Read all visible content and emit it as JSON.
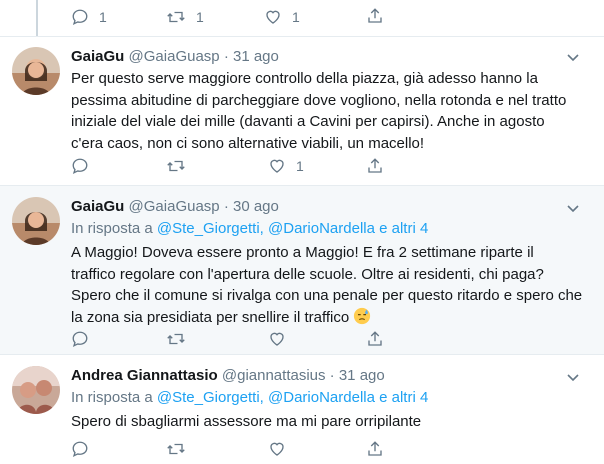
{
  "top_actions": {
    "reply_count": "1",
    "retweet_count": "1",
    "like_count": "1"
  },
  "tweets": [
    {
      "name": "GaiaGu",
      "handle": "@GaiaGuasp",
      "separator": "·",
      "time": "31 ago",
      "lines": [
        "Per questo serve maggiore controllo della piazza, già adesso hanno la",
        "pessima abitudine di parcheggiare dove vogliono, nella rotonda e nel tratto",
        "iniziale del viale dei mille (davanti a Cavini per capirsi). Anche in agosto",
        "c'era caos, non ci sono alternative viabili, un macello!"
      ],
      "reply_count": "",
      "retweet_count": "",
      "like_count": "1"
    },
    {
      "name": "GaiaGu",
      "handle": "@GaiaGuasp",
      "separator": "·",
      "time": "30 ago",
      "replying_prefix": "In risposta a ",
      "replying_user": "@Ste_Giorgetti",
      "replying_sep": ", ",
      "replying_user2": "@DarioNardella",
      "replying_others": " e altri 4",
      "lines": [
        "A Maggio! Doveva essere pronto a Maggio! E fra 2 settimane riparte il",
        "traffico regolare con l'apertura delle scuole. Oltre ai residenti, chi paga?",
        "Spero che il comune si rivalga con una penale per questo ritardo e spero che",
        "la zona sia presidiata per snellire il traffico"
      ],
      "emoji": "sweat-face-emoji"
    },
    {
      "name": "Andrea Giannattasio",
      "handle": "@giannattasius",
      "separator": "·",
      "time": "31 ago",
      "replying_prefix": "In risposta a ",
      "replying_user": "@Ste_Giorgetti",
      "replying_sep": ", ",
      "replying_user2": "@DarioNardella",
      "replying_others": " e altri 4",
      "lines": [
        "Spero di sbagliarmi assessore ma mi pare orripilante"
      ]
    }
  ],
  "colors": {
    "accent": "#1da1f2",
    "muted": "#657786",
    "text": "#14171a",
    "reply_bg": "#f5f8fa"
  }
}
